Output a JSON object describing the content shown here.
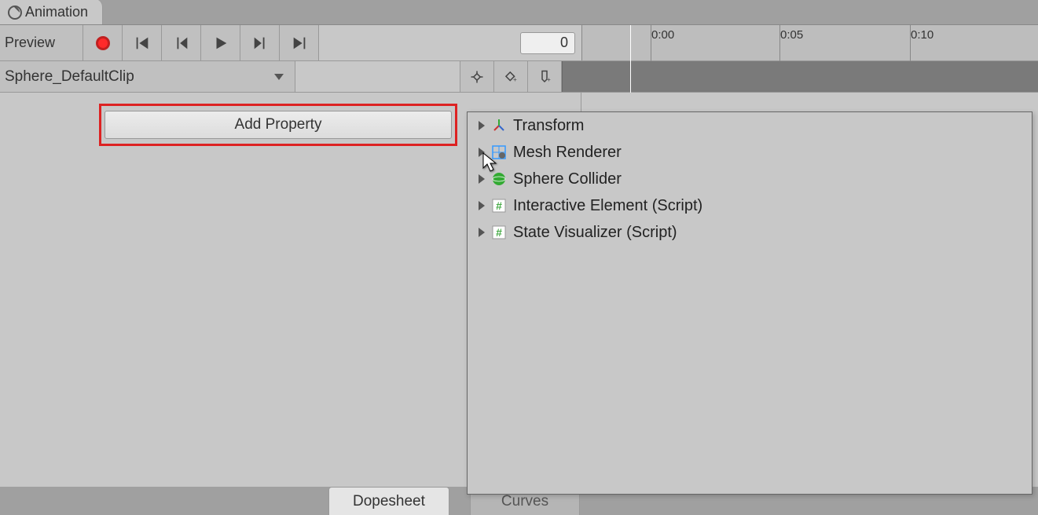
{
  "tab": {
    "title": "Animation"
  },
  "controls": {
    "preview": "Preview",
    "frame_value": "0"
  },
  "timeline": {
    "ticks": [
      "0:00",
      "0:05",
      "0:10"
    ]
  },
  "clip": {
    "name": "Sphere_DefaultClip"
  },
  "add_property": {
    "label": "Add Property"
  },
  "property_popup": {
    "items": [
      {
        "label": "Transform",
        "icon": "transform"
      },
      {
        "label": "Mesh Renderer",
        "icon": "mesh"
      },
      {
        "label": "Sphere Collider",
        "icon": "sphere"
      },
      {
        "label": "Interactive Element (Script)",
        "icon": "script"
      },
      {
        "label": "State Visualizer (Script)",
        "icon": "script"
      }
    ]
  },
  "bottom": {
    "dopesheet": "Dopesheet",
    "curves": "Curves"
  }
}
